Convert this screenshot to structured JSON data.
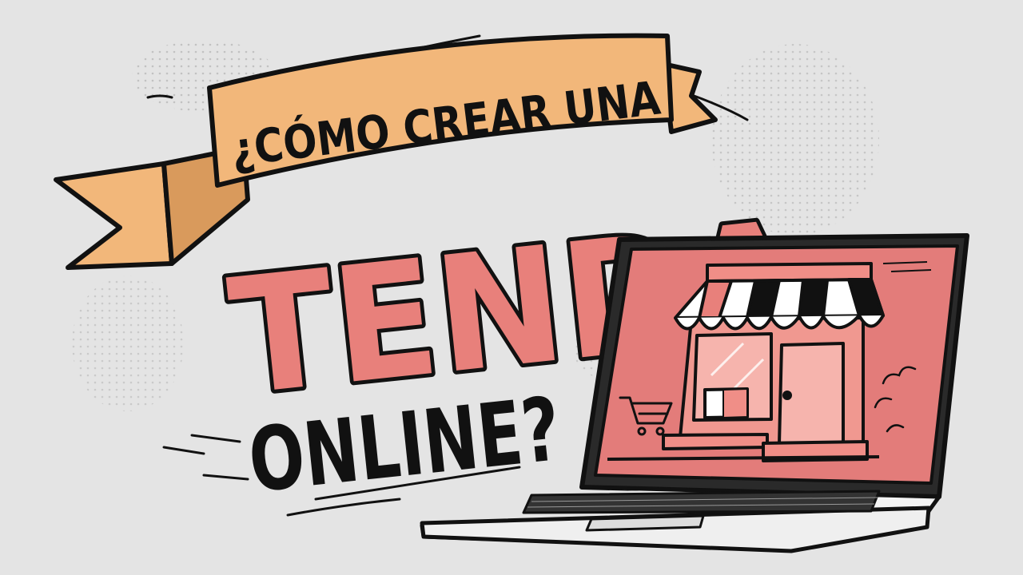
{
  "banner": {
    "text": "¿CÓMO CREAR UNA"
  },
  "headline": {
    "big_word": "TENDA",
    "second_line": "ONLINE?"
  },
  "colors": {
    "background": "#e4e4e4",
    "ribbon": "#f2b77a",
    "pink": "#e8807b",
    "screen": "#e37c7a",
    "outline": "#111111"
  },
  "icons": [
    "laptop-icon",
    "storefront-icon",
    "awning-icon",
    "shopping-cart-icon",
    "cloud-icon"
  ]
}
